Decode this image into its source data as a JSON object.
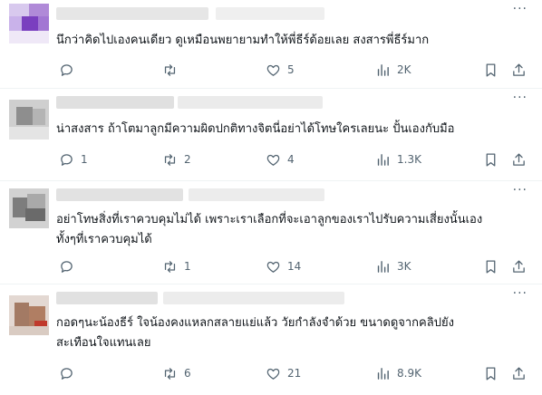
{
  "more_label": "···",
  "icons": {
    "reply": "reply-icon",
    "repost": "repost-icon",
    "like": "like-icon",
    "views": "views-icon",
    "bookmark": "bookmark-icon",
    "share": "share-icon"
  },
  "colors": {
    "text": "#0f1419",
    "muted": "#536471",
    "divider": "#eff3f4"
  },
  "posts": [
    {
      "lines": [
        "นึกว่าคิดไปเองคนเดียว ดูเหมือนพยายามทำให้พี่ธีร์ด้อยเลย สงสารพี่ธีร์มาก"
      ],
      "reply": "",
      "repost": "",
      "like": "5",
      "views": "2K"
    },
    {
      "lines": [
        "น่าสงสาร ถ้าโตมาลูกมีความผิดปกติทางจิตนี่อย่าได้โทษใครเลยนะ ปั้นเองกับมือ"
      ],
      "reply": "1",
      "repost": "2",
      "like": "4",
      "views": "1.3K"
    },
    {
      "lines": [
        "อย่าโทษสิ่งที่เราควบคุมไม่ได้ เพราะเราเลือกที่จะเอาลูกของเราไปรับความเสี่ยงนั้นเอง",
        "ทั้งๆที่เราควบคุมได้"
      ],
      "reply": "",
      "repost": "1",
      "like": "14",
      "views": "3K"
    },
    {
      "lines": [
        "กอดๆนะน้องธีร์ ใจน้องคงแหลกสลายแย่แล้ว วัยกำลังจำด้วย ขนาดดูจากคลิปยัง",
        "สะเทือนใจแทนเลย"
      ],
      "reply": "",
      "repost": "6",
      "like": "21",
      "views": "8.9K"
    }
  ]
}
